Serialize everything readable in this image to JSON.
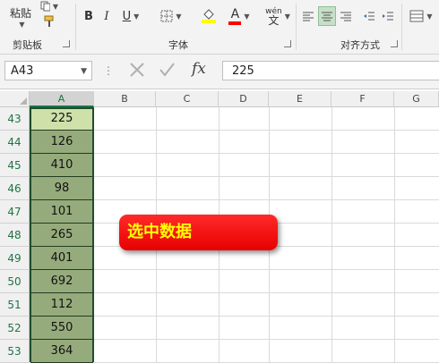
{
  "ribbon": {
    "paste_label": "粘贴",
    "groups": {
      "clipboard": "剪贴板",
      "font": "字体",
      "alignment": "对齐方式"
    },
    "font_buttons": {
      "bold": "B",
      "italic": "I",
      "underline": "U",
      "font_color": "A",
      "phonetic": "wén"
    },
    "accent_color": "#217346",
    "font_color_bar": "#ff0000",
    "fill_color_bar": "#ffff00"
  },
  "formula_bar": {
    "name_box": "A43",
    "fx_label": "fx",
    "value": "225"
  },
  "columns": [
    "A",
    "B",
    "C",
    "D",
    "E",
    "F",
    "G"
  ],
  "rows": [
    {
      "num": "43",
      "a": "225"
    },
    {
      "num": "44",
      "a": "126"
    },
    {
      "num": "45",
      "a": "410"
    },
    {
      "num": "46",
      "a": "98"
    },
    {
      "num": "47",
      "a": "101"
    },
    {
      "num": "48",
      "a": "265"
    },
    {
      "num": "49",
      "a": "401"
    },
    {
      "num": "50",
      "a": "692"
    },
    {
      "num": "51",
      "a": "112"
    },
    {
      "num": "52",
      "a": "550"
    },
    {
      "num": "53",
      "a": "364"
    }
  ],
  "callout": {
    "text": "选中数据",
    "background": "#ff0000",
    "text_color": "#ffff00"
  }
}
